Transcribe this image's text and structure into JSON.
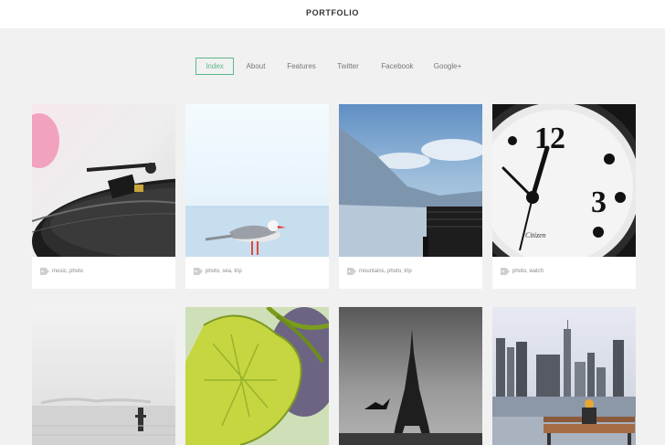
{
  "header": {
    "title": "PORTFOLIO"
  },
  "nav": [
    {
      "label": "Index",
      "active": true
    },
    {
      "label": "About"
    },
    {
      "label": "Features"
    },
    {
      "label": "Twitter"
    },
    {
      "label": "Facebook"
    },
    {
      "label": "Google+"
    }
  ],
  "cards": [
    {
      "image": "turntable-photo",
      "tags": "music, photo"
    },
    {
      "image": "seagull-photo",
      "tags": "photo, sea, trip"
    },
    {
      "image": "mountains-lake-photo",
      "tags": "mountains, photo, trip"
    },
    {
      "image": "clock-photo",
      "tags": "photo, watch"
    },
    {
      "image": "foggy-sea-photo",
      "tags": ""
    },
    {
      "image": "leaf-photo",
      "tags": ""
    },
    {
      "image": "eiffel-tower-photo",
      "tags": ""
    },
    {
      "image": "city-skyline-photo",
      "tags": ""
    }
  ],
  "colors": {
    "accent": "#5cb88a",
    "background": "#f1f1f1",
    "card": "#ffffff"
  }
}
